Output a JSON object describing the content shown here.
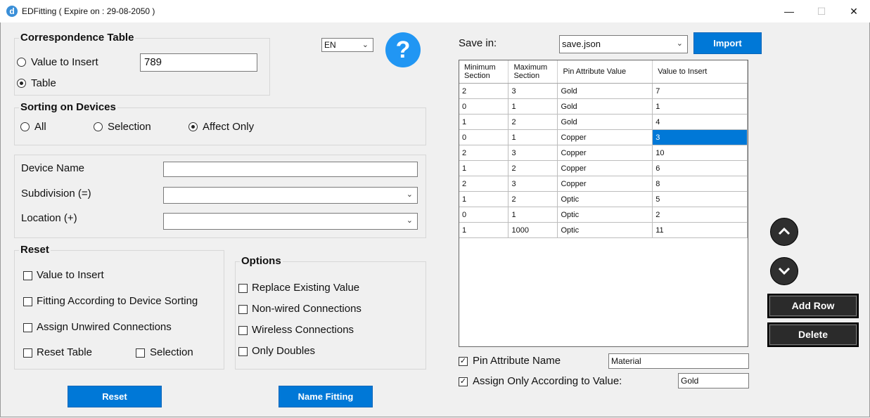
{
  "window": {
    "title": "EDFitting  ( Expire on : 29-08-2050 )",
    "icon_letter": "d",
    "minimize": "—",
    "maximize": "☐",
    "close": "✕"
  },
  "correspondence": {
    "title": "Correspondence Table",
    "value_to_insert_label": "Value to Insert",
    "value_to_insert_selected": false,
    "value": "789",
    "table_label": "Table",
    "table_selected": true
  },
  "language": {
    "selected": "EN"
  },
  "help": {
    "icon": "question-icon",
    "glyph": "?"
  },
  "sorting": {
    "title": "Sorting on Devices",
    "options": [
      {
        "label": "All",
        "selected": false
      },
      {
        "label": "Selection",
        "selected": false
      },
      {
        "label": "Affect Only",
        "selected": true
      }
    ]
  },
  "device": {
    "name_label": "Device Name",
    "name_value": "",
    "subdivision_label": "Subdivision (=)",
    "subdivision_value": "",
    "location_label": "Location (+)",
    "location_value": ""
  },
  "reset_group": {
    "title": "Reset",
    "value_to_insert": "Value to Insert",
    "fitting": "Fitting According to Device Sorting",
    "assign_unwired": "Assign Unwired Connections",
    "reset_table": "Reset Table",
    "selection": "Selection"
  },
  "options_group": {
    "title": "Options",
    "replace_existing": "Replace Existing Value",
    "non_wired": "Non-wired Connections",
    "wireless": "Wireless Connections",
    "only_doubles": "Only Doubles"
  },
  "buttons": {
    "reset": "Reset",
    "name_fitting": "Name Fitting",
    "import": "Import",
    "add_row": "Add Row",
    "delete": "Delete"
  },
  "save": {
    "label": "Save in:",
    "file": "save.json"
  },
  "table": {
    "columns": [
      "Minimum Section",
      "Maximum Section",
      "Pin Attribute Value",
      "Value to Insert"
    ],
    "rows": [
      [
        "2",
        "3",
        "Gold",
        "7"
      ],
      [
        "0",
        "1",
        "Gold",
        "1"
      ],
      [
        "1",
        "2",
        "Gold",
        "4"
      ],
      [
        "0",
        "1",
        "Copper",
        "3"
      ],
      [
        "2",
        "3",
        "Copper",
        "10"
      ],
      [
        "1",
        "2",
        "Copper",
        "6"
      ],
      [
        "2",
        "3",
        "Copper",
        "8"
      ],
      [
        "1",
        "2",
        "Optic",
        "5"
      ],
      [
        "0",
        "1",
        "Optic",
        "2"
      ],
      [
        "1",
        "1000",
        "Optic",
        "11"
      ]
    ],
    "selected_cell": [
      3,
      3
    ]
  },
  "pin_attribute": {
    "label": "Pin Attribute Name",
    "checked": true,
    "value": "Material"
  },
  "assign_value": {
    "label": "Assign Only According to Value:",
    "checked": true,
    "value": "Gold"
  },
  "colors": {
    "accent": "#0078d7",
    "dark_button": "#2b2b2b",
    "help": "#2196f3"
  }
}
